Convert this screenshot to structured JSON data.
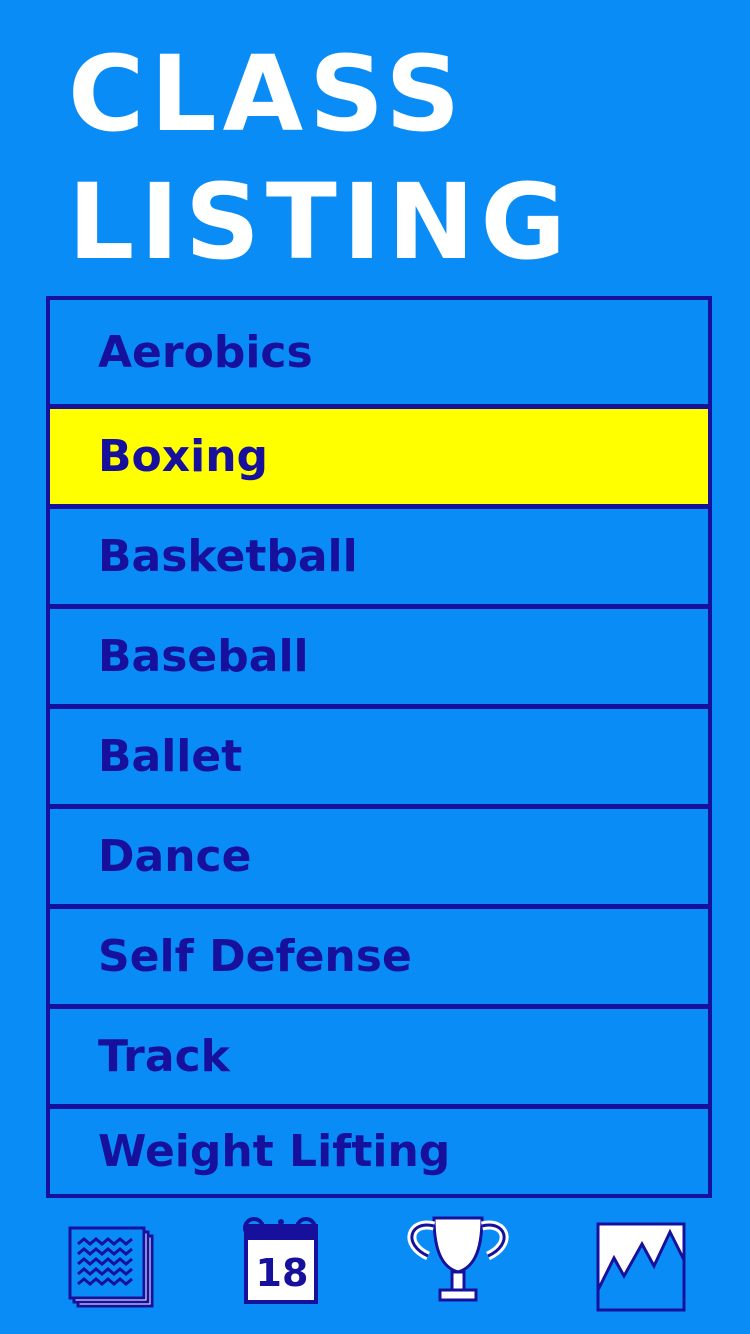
{
  "header": {
    "title_line1": "CLASS",
    "title_line2": "LISTING"
  },
  "classes": [
    {
      "label": "Aerobics",
      "selected": false
    },
    {
      "label": "Boxing",
      "selected": true
    },
    {
      "label": "Basketball",
      "selected": false
    },
    {
      "label": "Baseball",
      "selected": false
    },
    {
      "label": "Ballet",
      "selected": false
    },
    {
      "label": "Dance",
      "selected": false
    },
    {
      "label": "Self Defense",
      "selected": false
    },
    {
      "label": "Track",
      "selected": false
    },
    {
      "label": "Weight Lifting",
      "selected": false
    }
  ],
  "tabbar": {
    "tabs": [
      {
        "icon": "document-stack-icon"
      },
      {
        "icon": "calendar-icon",
        "text": "18"
      },
      {
        "icon": "trophy-icon"
      },
      {
        "icon": "chart-icon"
      }
    ]
  },
  "colors": {
    "background": "#0a8cf7",
    "accent": "#16109c",
    "highlight": "#ffff00",
    "title": "#ffffff"
  }
}
